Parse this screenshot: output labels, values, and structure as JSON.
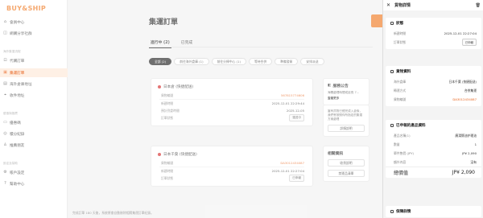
{
  "logo": "BUY&SHIP",
  "sidebar": {
    "top_items": [
      {
        "label": "會員中心",
        "icon": "home-icon"
      },
      {
        "label": "網購分享社群",
        "icon": "community-icon"
      }
    ],
    "section1": "海外集運流程",
    "flow_items": [
      {
        "label": "代購訂單",
        "icon": "cart-icon",
        "active": false
      },
      {
        "label": "集運訂單",
        "icon": "box-icon",
        "active": true
      },
      {
        "label": "海外倉庫地址",
        "icon": "warehouse-icon",
        "active": false
      },
      {
        "label": "收件地址",
        "icon": "address-icon",
        "active": false
      }
    ],
    "section2": "優惠與推薦",
    "promo_items": [
      {
        "label": "優惠碼",
        "icon": "coupon-icon"
      },
      {
        "label": "積分紀錄",
        "icon": "points-icon"
      },
      {
        "label": "推薦朋友",
        "icon": "referral-icon"
      }
    ],
    "section3": "設定及幫助",
    "setting_items": [
      {
        "label": "帳戶設定",
        "icon": "gear-icon"
      },
      {
        "label": "幫助中心",
        "icon": "help-icon"
      }
    ]
  },
  "main": {
    "title": "集運訂單",
    "tabs": [
      {
        "label": "進行中 (2)",
        "active": true
      },
      {
        "label": "已完成",
        "active": false
      }
    ],
    "filters": [
      {
        "label": "全部 (2)",
        "active": true
      },
      {
        "label": "前往海外倉庫 (1)",
        "active": false
      },
      {
        "label": "前往分揀中心 (1)",
        "active": false
      },
      {
        "label": "等待合併",
        "active": false
      },
      {
        "label": "準備發貨",
        "active": false
      },
      {
        "label": "安排派送",
        "active": false
      }
    ],
    "cards": [
      {
        "warehouse": "日本倉 (快捷配送)",
        "rows": [
          {
            "label": "貨物編號",
            "value": "567815774606",
            "type": "orange"
          },
          {
            "label": "新建時間",
            "value": "2025-12-01 22:29:44",
            "type": "text"
          },
          {
            "label": "預計到倉時間",
            "value": "2025-12-05",
            "type": "text"
          },
          {
            "label": "訂單狀態",
            "value": "運送中",
            "type": "badge"
          }
        ]
      },
      {
        "warehouse": "日本千葉 (快捷配送)",
        "rows": [
          {
            "label": "貨物編號",
            "value": "DA3012434087",
            "type": "orange"
          },
          {
            "label": "新建時間",
            "value": "2025-12-01 22:27:04",
            "type": "text"
          },
          {
            "label": "訂單狀態",
            "value": "已申報",
            "type": "badge"
          }
        ]
      }
    ],
    "announcement": {
      "title": "服務公告",
      "text": "海關處理時間或延長 7…",
      "link": "查看更多"
    },
    "notice": {
      "text": "當有貨物已經完成入倉後，我們會按照你所指定的集運方案處理",
      "button": "詳情說明"
    },
    "links": {
      "title": "相關資訊",
      "buttons": [
        "收費說明",
        "禁運品清單"
      ]
    },
    "footer": "完成訂單 180 天後，系統將會自動刪除相關集運訂單紀錄。"
  },
  "drawer": {
    "title": "貨物詳情",
    "status": {
      "title": "狀態",
      "rows": [
        {
          "label": "新建時間",
          "value": "2025-12-01 22:27:04",
          "type": "text"
        },
        {
          "label": "訂單狀態",
          "value": "已申報",
          "type": "badge"
        }
      ]
    },
    "cargo": {
      "title": "貨物資料",
      "rows": [
        {
          "label": "海外倉庫",
          "value": "日本千葉 (快捷配送)",
          "type": "text"
        },
        {
          "label": "轉運方式",
          "value": "合併集運",
          "type": "text"
        },
        {
          "label": "貨物編號",
          "value": "DA3012434087",
          "type": "orange"
        }
      ]
    },
    "declared": {
      "title": "已申報的產品資料",
      "rows": [
        {
          "label": "產品名稱(1)",
          "value": "廣湯簡油护理油",
          "type": "text"
        },
        {
          "label": "數量",
          "value": "1",
          "type": "text"
        },
        {
          "label": "單件售價 (JPY)",
          "value": "JP¥ 2,090",
          "type": "text"
        },
        {
          "label": "額外內容",
          "value": "沒有",
          "type": "text"
        }
      ],
      "total_label": "總價值",
      "total_value": "JP¥ 2,090"
    },
    "insurance": {
      "title": "保障詳情"
    }
  }
}
